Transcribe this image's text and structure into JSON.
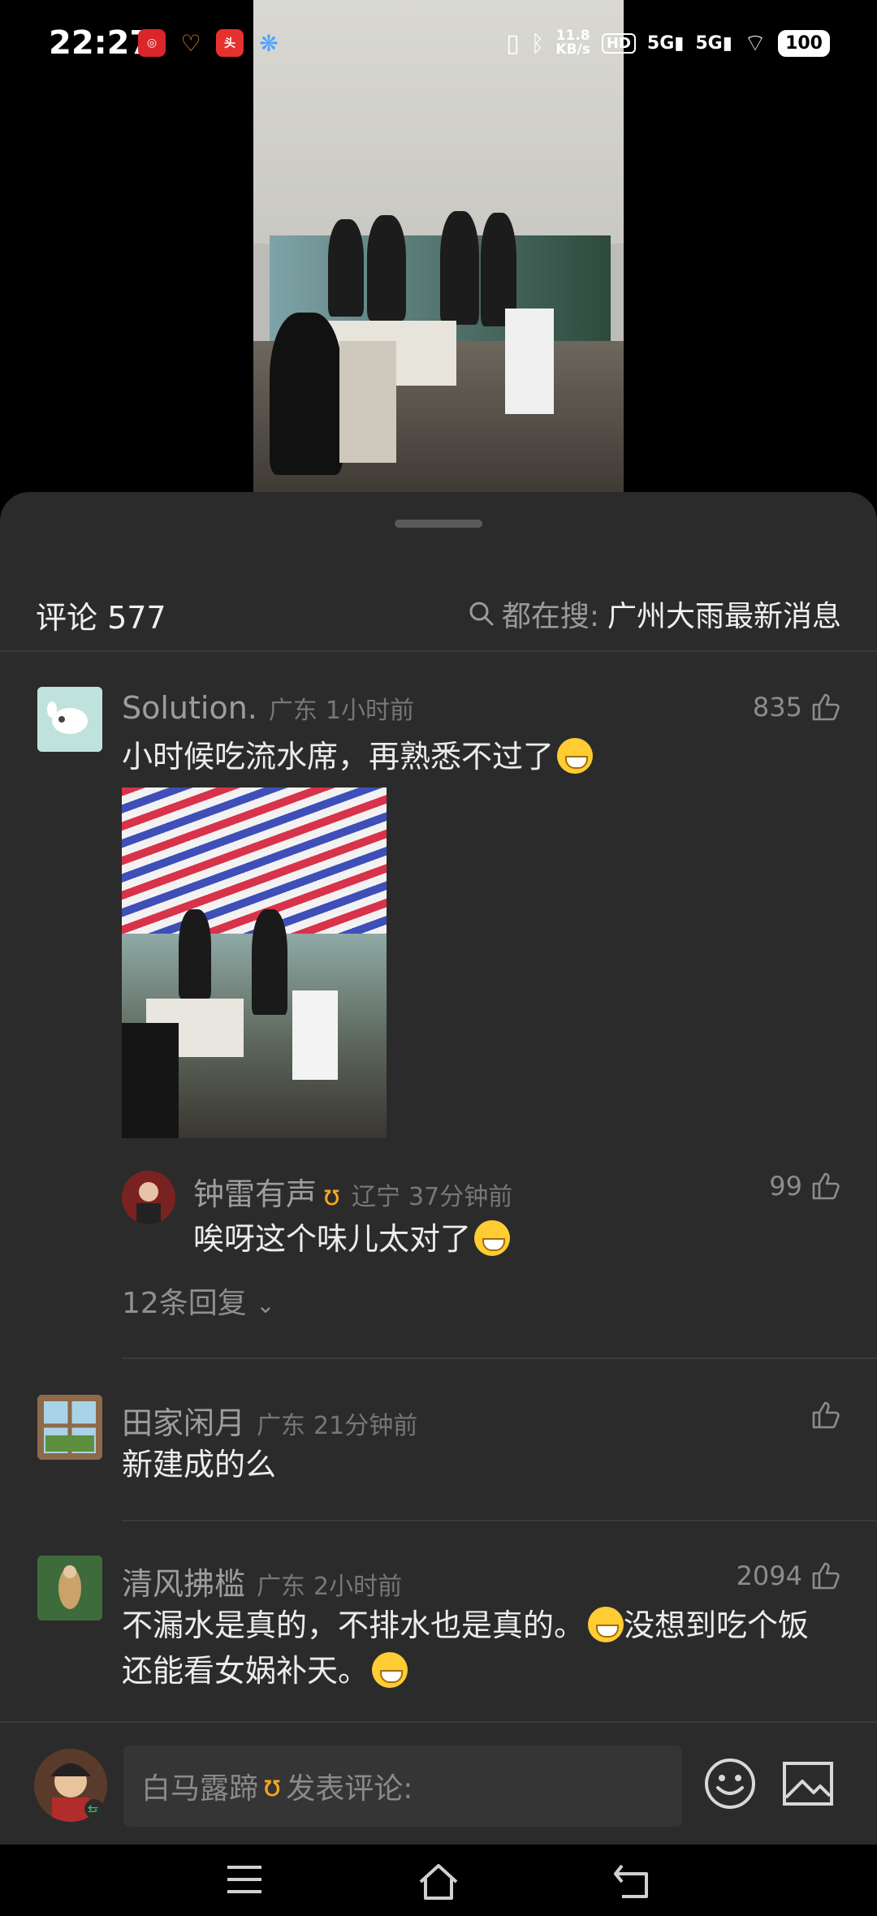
{
  "status_bar": {
    "time": "22:27",
    "net_speed_value": "11.8",
    "net_speed_unit": "KB/s",
    "hd_label": "HD",
    "signal_1": "5G",
    "signal_2": "5G",
    "battery": "100"
  },
  "sheet": {
    "title": "评论 577",
    "search_prefix": "都在搜:",
    "search_term": "广州大雨最新消息"
  },
  "comments": [
    {
      "name": "Solution.",
      "location": "广东",
      "time": "1小时前",
      "likes": "835",
      "text": "小时候吃流水席，再熟悉不过了",
      "reply": {
        "name": "钟雷有声",
        "location": "辽宁",
        "time": "37分钟前",
        "likes": "99",
        "text": "唉呀这个味儿太对了"
      },
      "more_replies": "12条回复"
    },
    {
      "name": "田家闲月",
      "location": "广东",
      "time": "21分钟前",
      "likes": "",
      "text": "新建成的么"
    },
    {
      "name": "清风拂槛",
      "location": "广东",
      "time": "2小时前",
      "likes": "2094",
      "text_line1": "不漏水是真的，不排水也是真的。",
      "text_line1b": "没想到吃个饭",
      "text_line2": "还能看女娲补天。"
    }
  ],
  "input_bar": {
    "user_name": "白马露蹄",
    "placeholder": "发表评论:"
  },
  "colors": {
    "sheet_bg": "#2b2b2b",
    "vip_badge": "#f5a623",
    "muted_text": "#9d9d9d"
  }
}
